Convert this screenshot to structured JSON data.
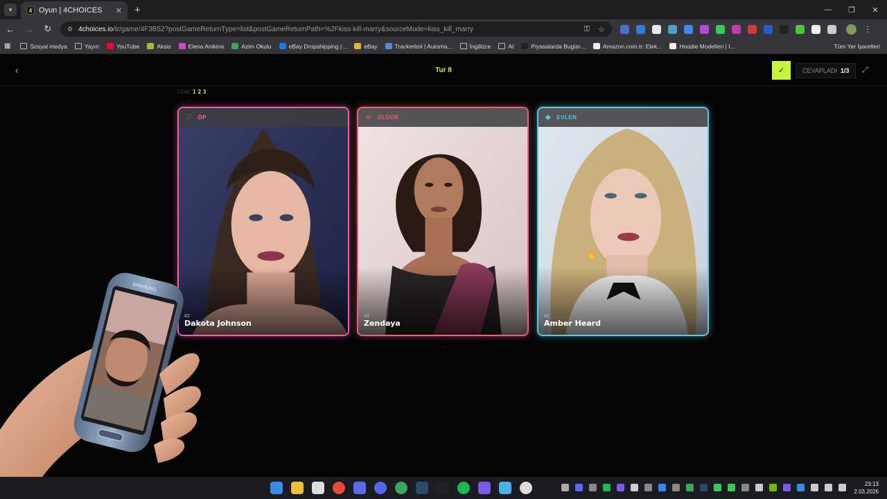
{
  "browser": {
    "tab_title": "Oyun | 4CHOICES",
    "tab_favicon": "4",
    "url_host": "4choices.io",
    "url_path": "/tr/game/4F3B52?postGameReturnType=list&postGameReturnPath=%2Fkiss-kill-marry&sourceMode=kiss_kill_marry",
    "bookmarks": [
      {
        "label": "Sosyal medya",
        "icon": "folder-icon",
        "color": ""
      },
      {
        "label": "Yayın",
        "icon": "folder-icon",
        "color": ""
      },
      {
        "label": "YouTube",
        "icon": "youtube-icon",
        "color": "#ff0033"
      },
      {
        "label": "Aksis",
        "icon": "aksis-icon",
        "color": "#9bbf3a"
      },
      {
        "label": "Elena Anikina",
        "icon": "elena-icon",
        "color": "#d04ad0"
      },
      {
        "label": "Azim Okulu",
        "icon": "azim-icon",
        "color": "#3aa85a"
      },
      {
        "label": "eBay Dropshipping |...",
        "icon": "facebook-icon",
        "color": "#1877f2"
      },
      {
        "label": "eBay",
        "icon": "ebay-icon",
        "color": "#e0b03a"
      },
      {
        "label": "Trackerbot | Automa...",
        "icon": "trackerbot-icon",
        "color": "#5a8ad0"
      },
      {
        "label": "İngilizce",
        "icon": "folder-icon",
        "color": ""
      },
      {
        "label": "AI",
        "icon": "folder-icon",
        "color": ""
      },
      {
        "label": "Piyasalarda Bugün...",
        "icon": "tv-icon",
        "color": "#222"
      },
      {
        "label": "Amazon.com.tr: Elek...",
        "icon": "amazon-icon",
        "color": "#eee"
      },
      {
        "label": "Hoodie Modelleri | I...",
        "icon": "hoodie-icon",
        "color": "#eee"
      }
    ],
    "bookmarks_right": "Tüm Yer İşaretleri"
  },
  "game": {
    "round_title": "Tur 8",
    "answered_label": "CEVAPLADI",
    "answered_count": "1/3",
    "chat_label": "Chat:",
    "chat_numbers": [
      "1",
      "2",
      "3"
    ],
    "accent": "#c6f53a",
    "cards": [
      {
        "choice": "ÖP",
        "icon": "heart-icon",
        "number": "#2",
        "name": "Dakota Johnson",
        "color": "#f05fa7"
      },
      {
        "choice": "ÖLDÜR",
        "icon": "skull-icon",
        "number": "#3",
        "name": "Zendaya",
        "color": "#f05f79"
      },
      {
        "choice": "EVLEN",
        "icon": "diamond-icon",
        "number": "#1",
        "name": "Amber Heard",
        "color": "#56cde6"
      }
    ]
  },
  "taskbar": {
    "time": "23:13",
    "date": "2.03.2026"
  }
}
